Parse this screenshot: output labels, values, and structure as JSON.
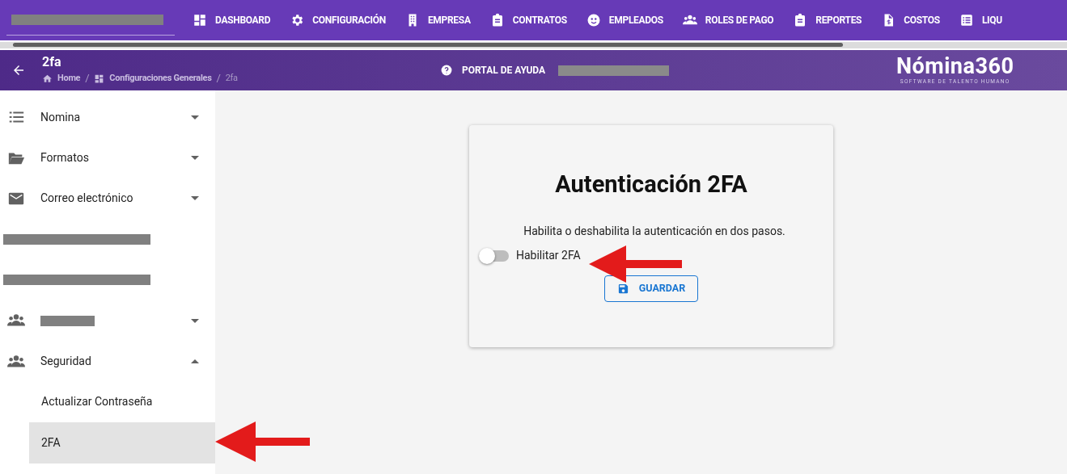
{
  "top_nav": {
    "items": [
      {
        "label": "DASHBOARD",
        "kind": "dashboard"
      },
      {
        "label": "CONFIGURACIÓN",
        "kind": "gear"
      },
      {
        "label": "EMPRESA",
        "kind": "building"
      },
      {
        "label": "CONTRATOS",
        "kind": "clipboard"
      },
      {
        "label": "EMPLEADOS",
        "kind": "face"
      },
      {
        "label": "ROLES DE PAGO",
        "kind": "people"
      },
      {
        "label": "REPORTES",
        "kind": "clipboard"
      },
      {
        "label": "COSTOS",
        "kind": "invoice"
      },
      {
        "label": "LIQU",
        "kind": "list"
      }
    ]
  },
  "header": {
    "title": "2fa",
    "breadcrumb": [
      {
        "label": "Home",
        "kind": "home"
      },
      {
        "label": "Configuraciones Generales",
        "kind": "dashboard"
      },
      {
        "label": "2fa",
        "kind": "current"
      }
    ],
    "separator": "/",
    "help": "PORTAL DE AYUDA",
    "logo": "Nómina360",
    "tagline": "SOFTWARE DE TALENTO HUMANO"
  },
  "sidebar": {
    "items": [
      {
        "label": "Nomina",
        "kind": "list",
        "expanded": false
      },
      {
        "label": "Formatos",
        "kind": "folder",
        "expanded": false
      },
      {
        "label": "Correo electrónico",
        "kind": "mail",
        "expanded": false
      },
      {
        "kind": "redacted"
      },
      {
        "kind": "redacted"
      },
      {
        "kind": "people-redacted",
        "expanded": false
      },
      {
        "label": "Seguridad",
        "kind": "people",
        "expanded": true,
        "children": [
          {
            "label": "Actualizar Contraseña",
            "selected": false
          },
          {
            "label": "2FA",
            "selected": true
          }
        ]
      }
    ]
  },
  "card": {
    "title": "Autenticación 2FA",
    "description": "Habilita o deshabilita la autenticación en dos pasos.",
    "toggle": {
      "label": "Habilitar 2FA",
      "on": false
    },
    "button": "GUARDAR"
  }
}
